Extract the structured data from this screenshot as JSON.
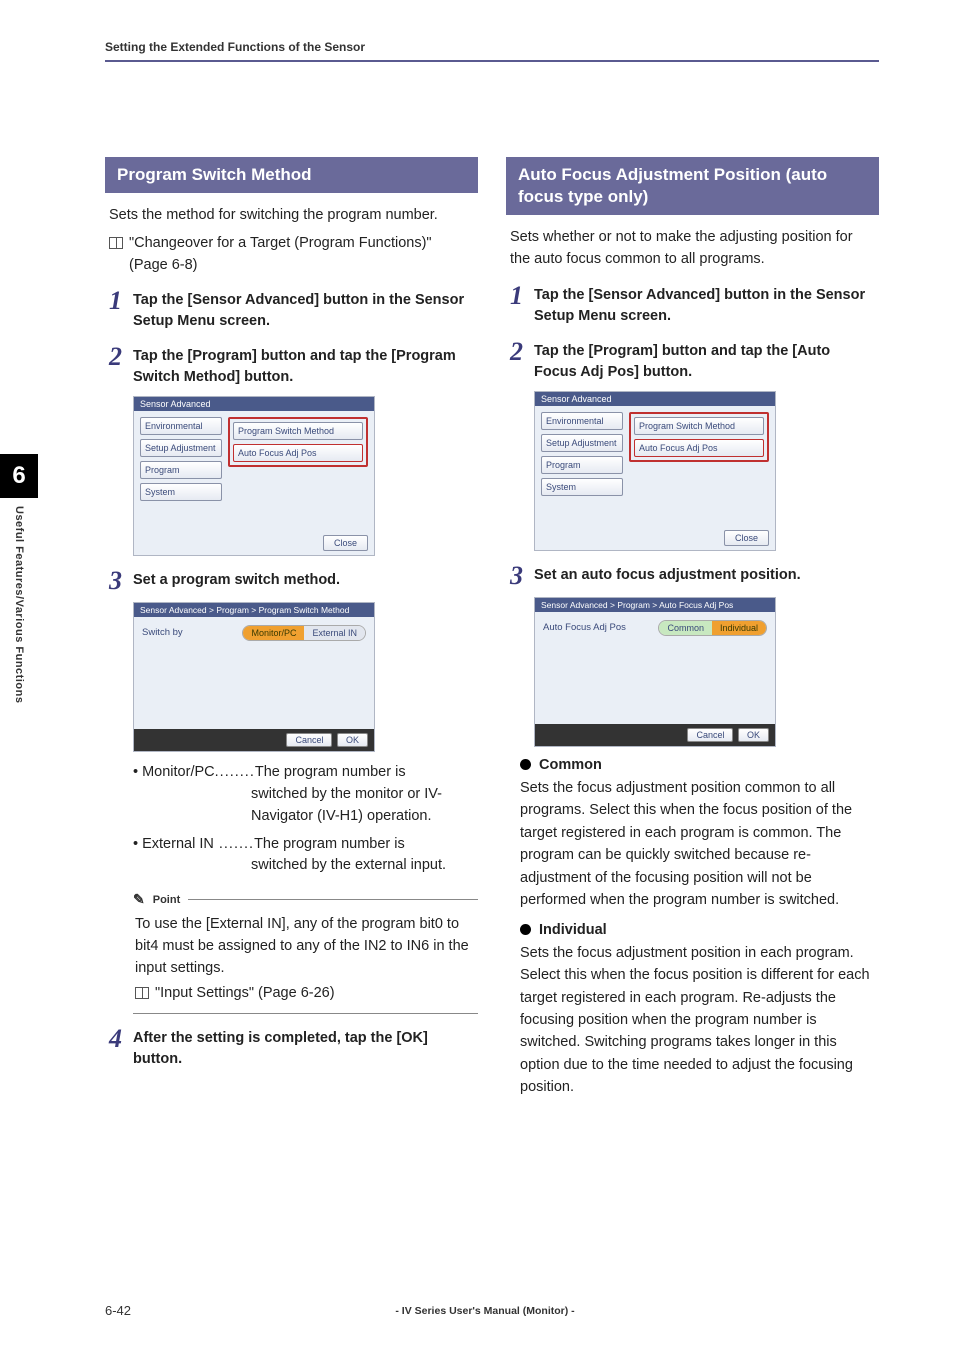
{
  "header": {
    "breadcrumb": "Setting the Extended Functions of the Sensor"
  },
  "sideTab": {
    "chapter": "6",
    "text": "Useful Features/Various Functions"
  },
  "left": {
    "title": "Program Switch Method",
    "intro": "Sets the method for switching the program number.",
    "ref": "\"Changeover for a Target (Program Functions)\" (Page 6-8)",
    "step1": "Tap the [Sensor Advanced] button in the Sensor Setup Menu screen.",
    "step2": "Tap the [Program] button and tap the [Program Switch Method] button.",
    "ss1": {
      "title": "Sensor Advanced",
      "leftBtns": [
        "Environmental",
        "Setup Adjustment",
        "Program",
        "System"
      ],
      "rightBtns": [
        "Program Switch Method",
        "Auto Focus Adj Pos"
      ],
      "close": "Close"
    },
    "step3": "Set a program switch method.",
    "ss2": {
      "title": "Sensor Advanced > Program > Program Switch Method",
      "label": "Switch by",
      "opt1": "Monitor/PC",
      "opt2": "External IN",
      "cancel": "Cancel",
      "ok": "OK"
    },
    "def1term": "• Monitor/PC",
    "def1dots": "........",
    "def1val1": "The program number is",
    "def1val2": "switched by the monitor or IV-Navigator (IV-H1) operation.",
    "def2term": "• External IN",
    "def2dots": " .......",
    "def2val1": "The program number is",
    "def2val2": "switched by the external input.",
    "pointLabel": "Point",
    "pointBody": "To use the [External IN], any of the program bit0 to bit4 must be assigned to any of the IN2 to IN6 in the input settings.",
    "pointRef": "\"Input Settings\" (Page 6-26)",
    "step4": "After the setting is completed, tap the [OK] button."
  },
  "right": {
    "title": "Auto Focus Adjustment Position (auto focus type only)",
    "intro": "Sets whether or not to make the adjusting position for the auto focus common to all programs.",
    "step1": "Tap the [Sensor Advanced] button in the Sensor Setup Menu screen.",
    "step2": "Tap the [Program] button and tap the [Auto Focus Adj Pos] button.",
    "ss1": {
      "title": "Sensor Advanced",
      "leftBtns": [
        "Environmental",
        "Setup Adjustment",
        "Program",
        "System"
      ],
      "rightBtns": [
        "Program Switch Method",
        "Auto Focus Adj Pos"
      ],
      "close": "Close"
    },
    "step3": "Set an auto focus adjustment position.",
    "ss2": {
      "title": "Sensor Advanced > Program > Auto Focus Adj Pos",
      "label": "Auto Focus Adj Pos",
      "opt1": "Common",
      "opt2": "Individual",
      "cancel": "Cancel",
      "ok": "OK"
    },
    "commonH": "Common",
    "commonBody": "Sets the focus adjustment position common to all programs. Select this when the focus position of the target registered in each program is common. The program can be quickly switched because re-adjustment of the focusing position will not be performed when the program number is switched.",
    "individualH": "Individual",
    "individualBody": "Sets the focus adjustment position in each program. Select this when the focus position is different for each target registered in each program. Re-adjusts the focusing position when the program number is switched. Switching programs takes longer in this option due to the time needed to adjust the focusing position."
  },
  "footer": {
    "page": "6-42",
    "title": "- IV Series User's Manual (Monitor) -"
  }
}
